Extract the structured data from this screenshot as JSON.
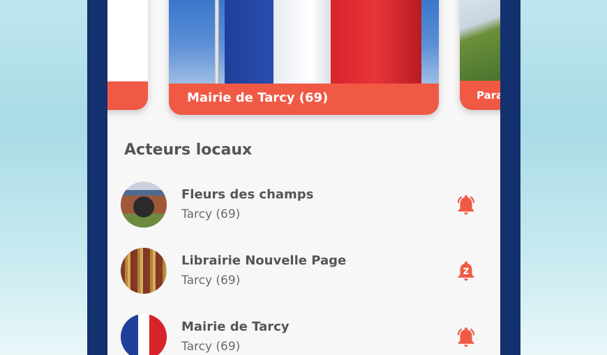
{
  "carousel": {
    "cards": [
      {
        "caption": ""
      },
      {
        "caption": "Mairie de Tarcy (69)"
      },
      {
        "caption": "Para"
      }
    ]
  },
  "section": {
    "title": "Acteurs locaux"
  },
  "actors": [
    {
      "name": "Fleurs des champs",
      "location": "Tarcy (69)",
      "bell": "bell-icon"
    },
    {
      "name": "Librairie Nouvelle Page",
      "location": "Tarcy (69)",
      "bell": "bell-snooze-icon"
    },
    {
      "name": "Mairie de Tarcy",
      "location": "Tarcy (69)",
      "bell": "bell-icon"
    }
  ],
  "colors": {
    "accent": "#f05a45",
    "frame": "#13306f",
    "text": "#555555"
  }
}
